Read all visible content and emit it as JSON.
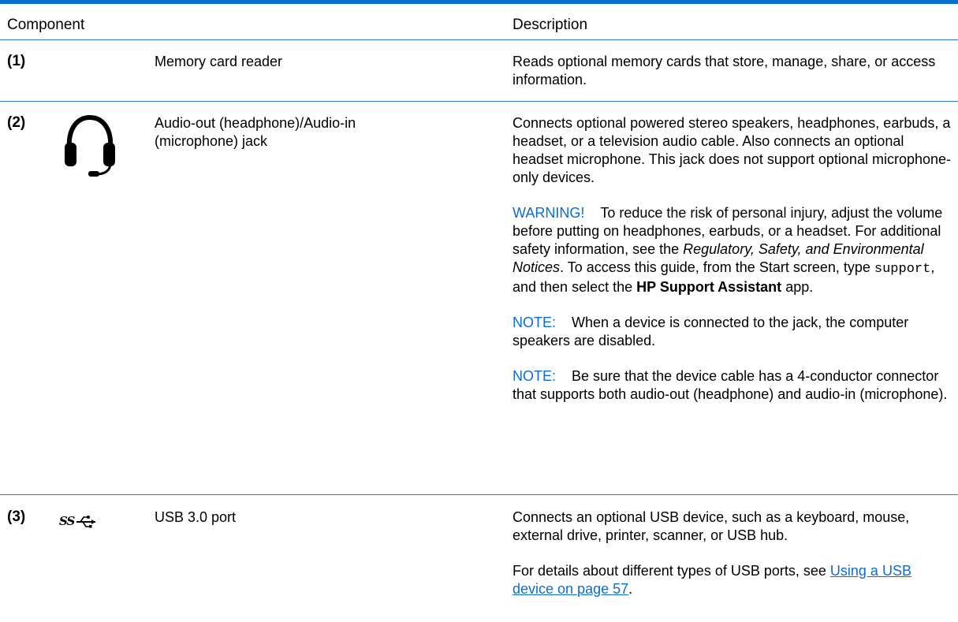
{
  "header": {
    "component": "Component",
    "description": "Description"
  },
  "rows": [
    {
      "number": "(1)",
      "component": "Memory card reader",
      "description": "Reads optional memory cards that store, manage, share, or access information."
    },
    {
      "number": "(2)",
      "icon": "headphone-icon",
      "component": "Audio-out (headphone)/Audio-in (microphone) jack",
      "description": "Connects optional powered stereo speakers, headphones, earbuds, a headset, or a television audio cable. Also connects an optional headset microphone. This jack does not support optional microphone-only devices.",
      "warning": {
        "label": "WARNING!",
        "text_1": "To reduce the risk of personal injury, adjust the volume before putting on headphones, earbuds, or a headset. For additional safety information, see the",
        "doc_title": "Regulatory, Safety, and Environmental Notices",
        "text_2": ". To access this guide, from the Start screen, type",
        "command": "support",
        "text_3": ", and then select the",
        "app_name": "HP Support Assistant",
        "text_4": "app."
      },
      "notes": [
        {
          "label": "NOTE:",
          "text": "When a device is connected to the jack, the computer speakers are disabled."
        },
        {
          "label": "NOTE:",
          "text": "Be sure that the device cable has a 4-conductor connector that supports both audio-out (headphone) and audio-in (microphone)."
        }
      ]
    },
    {
      "number": "(3)",
      "icon": "usb-superspeed-icon",
      "icon_text": "SS",
      "component": "USB 3.0 port",
      "description": "Connects an optional USB device, such as a keyboard, mouse, external drive, printer, scanner, or USB hub.",
      "details_prefix": "For details about different types of USB ports, see",
      "details_link": "Using a USB device on page 57",
      "details_suffix": "."
    }
  ],
  "colors": {
    "accent": "#0a6dd6"
  }
}
